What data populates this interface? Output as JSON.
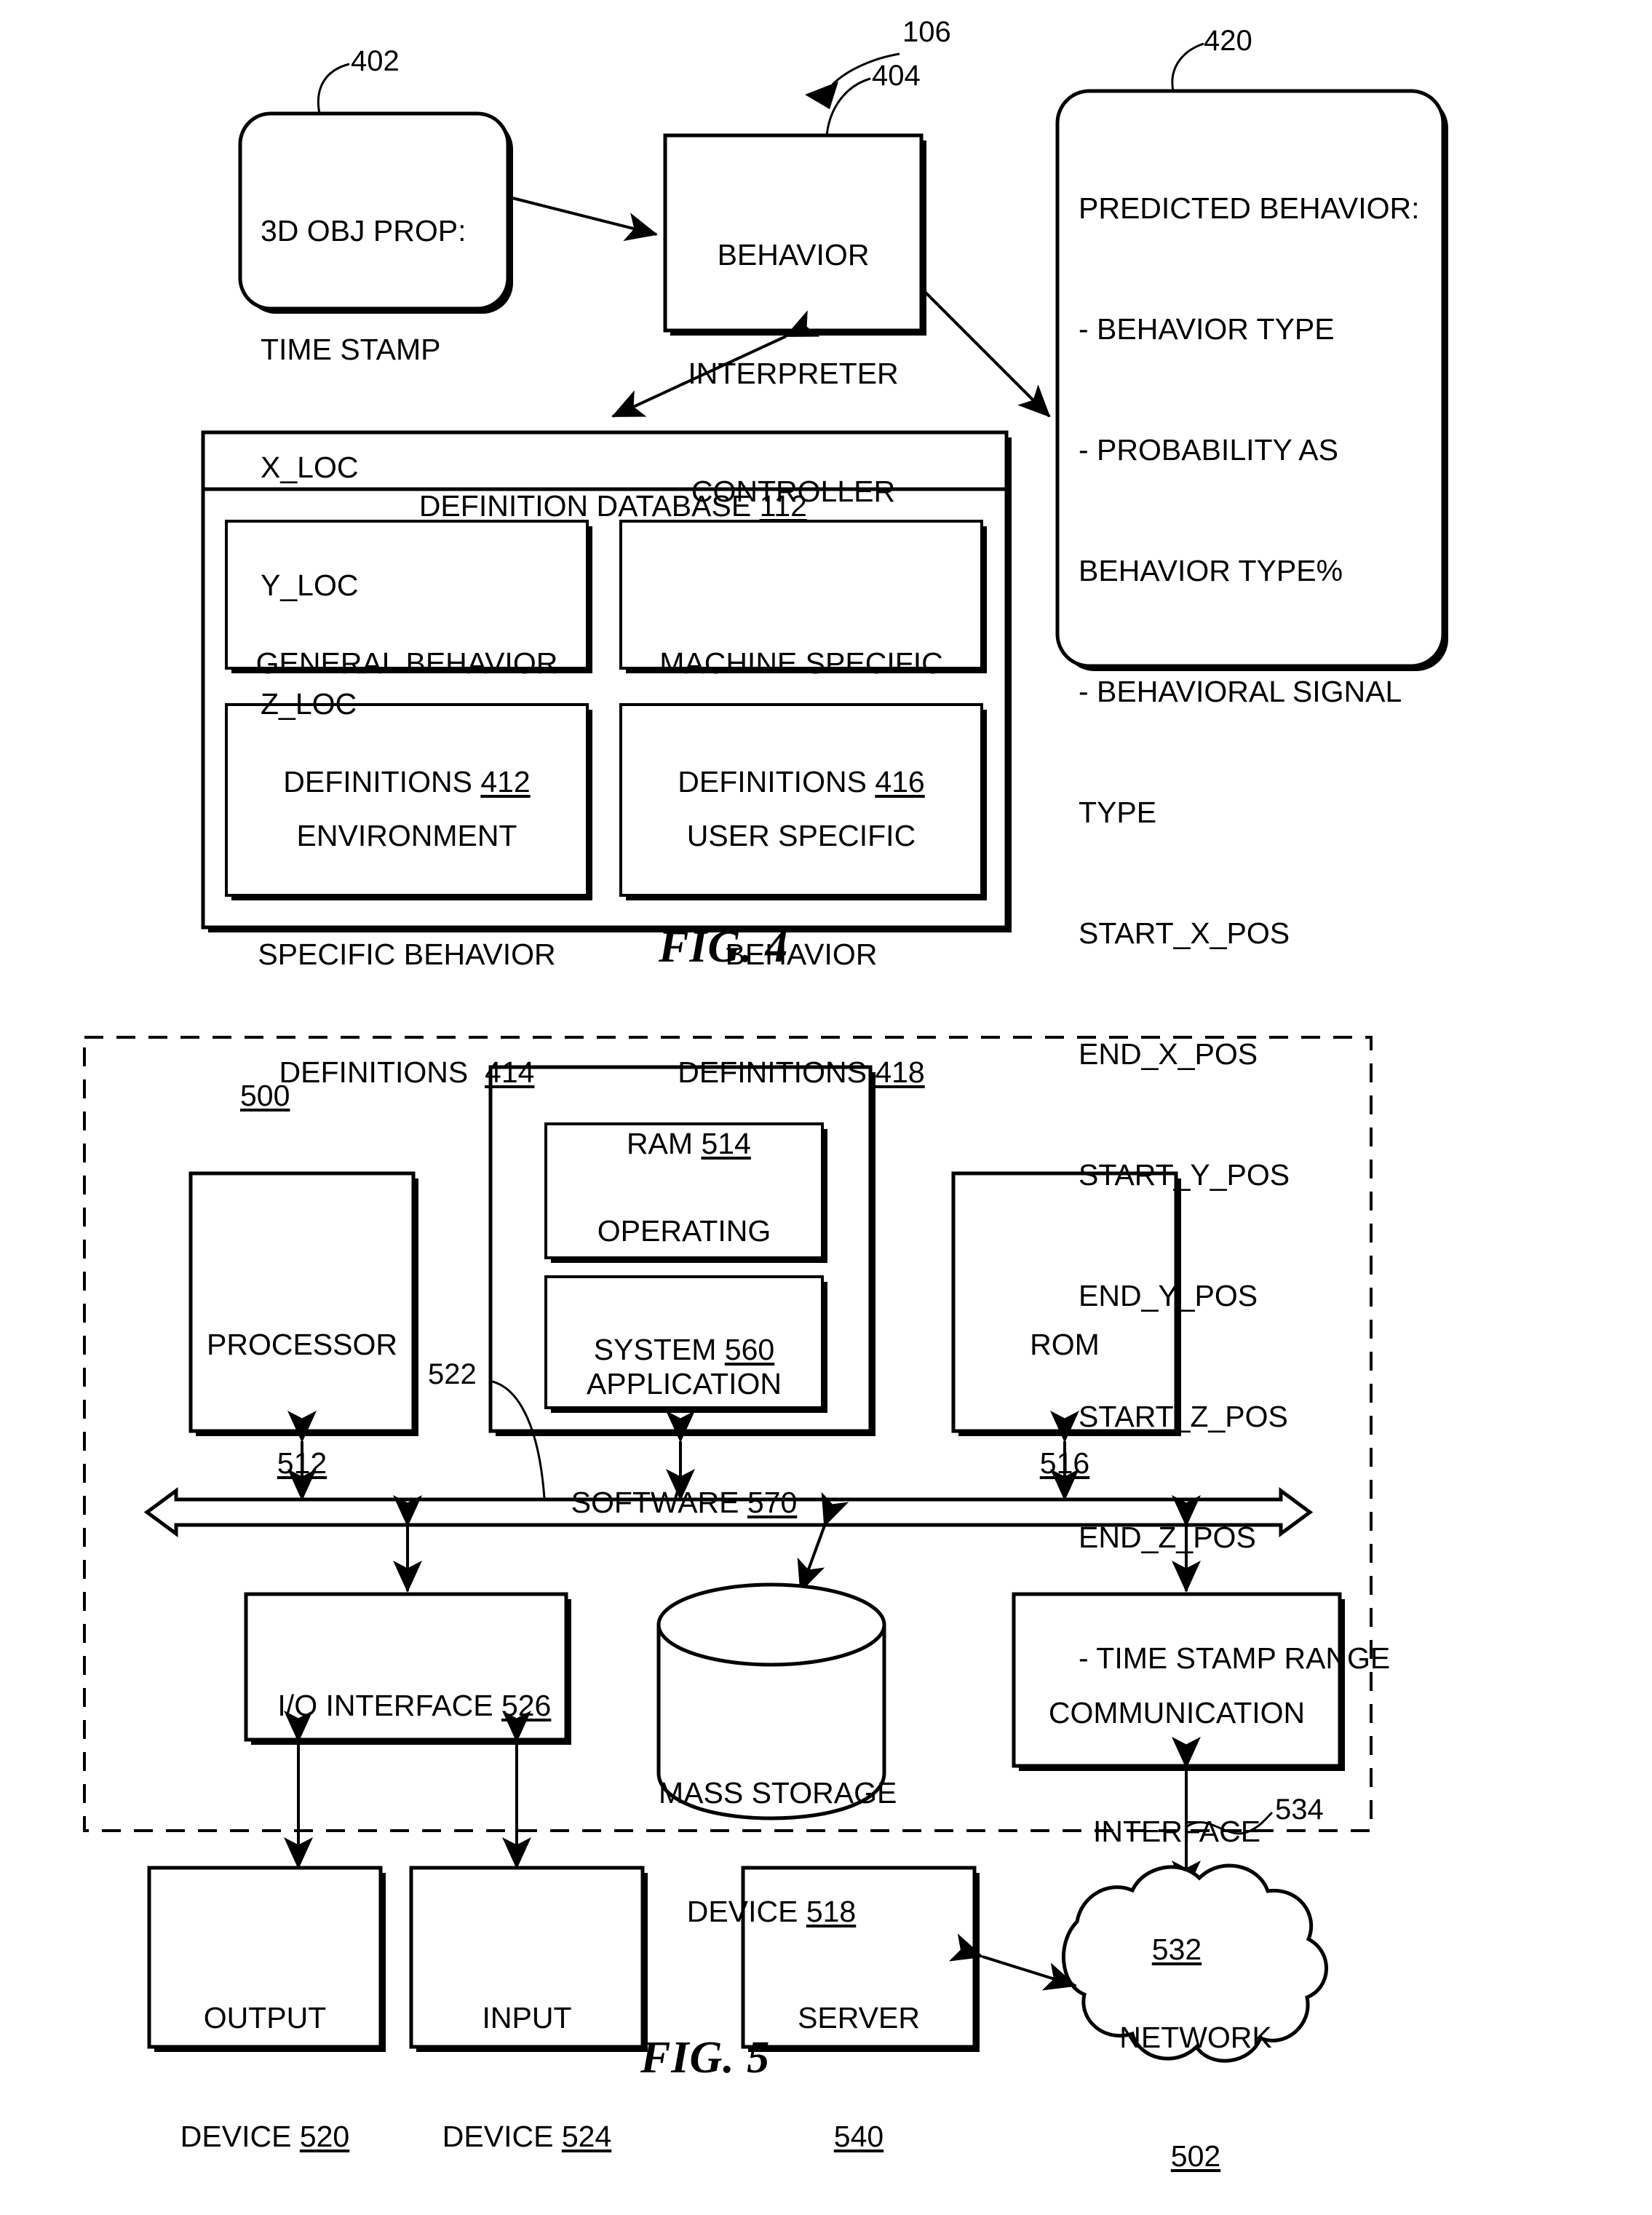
{
  "figure4": {
    "caption": "FIG. 4",
    "leaders": {
      "obj_prop": "402",
      "system": "106",
      "controller": "404",
      "predicted": "420"
    },
    "obj_prop_box": {
      "title": "3D OBJ PROP:",
      "fields": [
        "TIME STAMP",
        "X_LOC",
        "Y_LOC",
        "Z_LOC"
      ]
    },
    "controller_box": {
      "lines": [
        "BEHAVIOR",
        "INTERPRETER",
        "CONTROLLER"
      ]
    },
    "predicted_box": {
      "title": "PREDICTED BEHAVIOR:",
      "lines": [
        "- BEHAVIOR TYPE",
        "- PROBABILITY AS",
        "BEHAVIOR TYPE%",
        "- BEHAVIORAL SIGNAL",
        "TYPE",
        "START_X_POS",
        "END_X_POS",
        "START_Y_POS",
        "END_Y_POS",
        "START_Z_POS",
        "END_Z_POS",
        "- TIME STAMP RANGE"
      ]
    },
    "database": {
      "title": "DEFINITION DATABASE",
      "title_ref": "112",
      "cells": [
        {
          "lines": [
            "GENERAL BEHAVIOR",
            "DEFINITIONS "
          ],
          "ref": "412"
        },
        {
          "lines": [
            "MACHINE SPECIFIC",
            "DEFINITIONS "
          ],
          "ref": "416"
        },
        {
          "lines": [
            "ENVIRONMENT",
            "SPECIFIC BEHAVIOR",
            "DEFINITIONS  "
          ],
          "ref": "414"
        },
        {
          "lines": [
            "USER SPECIFIC",
            "BEHAVIOR",
            "DEFINITIONS "
          ],
          "ref": "418"
        }
      ]
    }
  },
  "figure5": {
    "caption": "FIG. 5",
    "system_ref": "500",
    "bus_ref": "522",
    "link_ref": "534",
    "processor": {
      "label": "PROCESSOR",
      "ref": "512"
    },
    "ram": {
      "label": "RAM ",
      "ref": "514",
      "children": [
        {
          "lines": [
            "OPERATING",
            "SYSTEM "
          ],
          "ref": "560"
        },
        {
          "lines": [
            "APPLICATION",
            "SOFTWARE "
          ],
          "ref": "570"
        }
      ]
    },
    "rom": {
      "label": "ROM",
      "ref": "516"
    },
    "io_interface": {
      "label": "I/O INTERFACE ",
      "ref": "526"
    },
    "mass_storage": {
      "lines": [
        "MASS STORAGE",
        "DEVICE "
      ],
      "ref": "518"
    },
    "comm_interface": {
      "lines": [
        "COMMUNICATION",
        "INTERFACE"
      ],
      "ref": "532"
    },
    "output_device": {
      "lines": [
        "OUTPUT",
        "DEVICE "
      ],
      "ref": "520"
    },
    "input_device": {
      "lines": [
        "INPUT",
        "DEVICE "
      ],
      "ref": "524"
    },
    "server": {
      "label": "SERVER",
      "ref": "540"
    },
    "network": {
      "label": "NETWORK",
      "ref": "502"
    }
  }
}
